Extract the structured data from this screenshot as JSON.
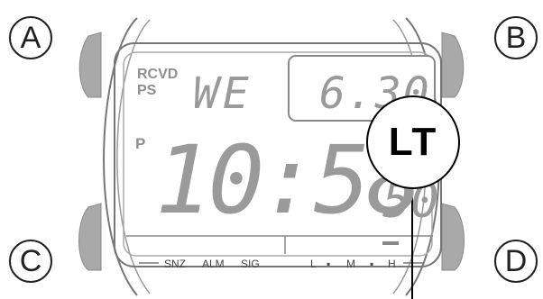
{
  "buttons": {
    "a": "A",
    "b": "B",
    "c": "C",
    "d": "D"
  },
  "display": {
    "indicator_rcvd": "RCVD",
    "indicator_ps": "PS",
    "indicator_p": "P",
    "weekday": "WE",
    "date": "6.30",
    "time": "10:58",
    "seconds": "50"
  },
  "bottom_labels": {
    "snz": "SNZ",
    "alm": "ALM",
    "sig": "SIG",
    "l": "L",
    "m": "M",
    "h": "H"
  },
  "callout": "LT"
}
